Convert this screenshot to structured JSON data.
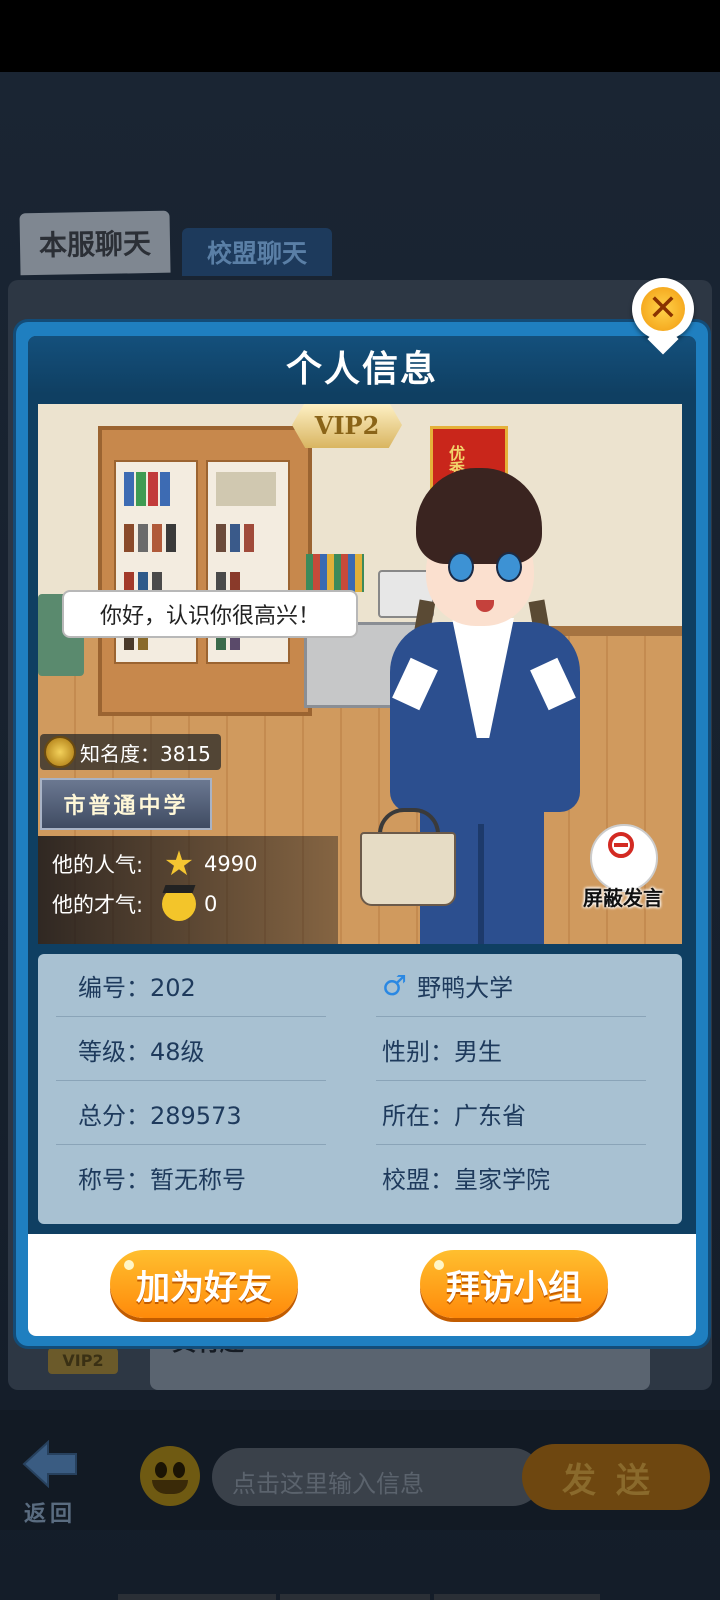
{
  "chat": {
    "tabs": [
      "本服聊天",
      "校盟聊天"
    ],
    "message_vip": "VIP2",
    "message_text": "真有趣",
    "back_label": "返回",
    "input_placeholder": "点击这里输入信息",
    "send_label": "发送"
  },
  "dialog": {
    "title": "个人信息",
    "close_glyph": "✕",
    "scene": {
      "vip_label": "VIP2",
      "banner_text": "优秀",
      "speech": "你好，认识你很高兴！",
      "fame_label": "知名度：3815",
      "school_plate": "市普通中学",
      "popularity_label": "他的人气:",
      "popularity_value": "4990",
      "talent_label": "他的才气:",
      "talent_value": "0",
      "block_label": "屏蔽发言"
    },
    "info": {
      "id": "编号：202",
      "university": "野鸭大学",
      "level": "等级：48级",
      "gender": "性别：男生",
      "score": "总分：289573",
      "location": "所在：广东省",
      "title": "称号：暂无称号",
      "alliance": "校盟：皇家学院"
    },
    "buttons": {
      "add_friend": "加为好友",
      "visit_group": "拜访小组"
    }
  }
}
